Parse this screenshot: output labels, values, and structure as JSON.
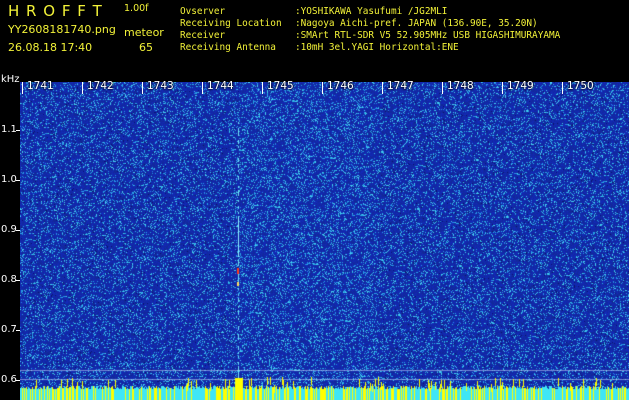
{
  "header": {
    "brand": "H R O F F T",
    "version": "1.00f",
    "filename": "YY2608181740.png",
    "meteor_label": "meteor",
    "datetime": "26.08.18 17:40",
    "meteor_count": "65",
    "info_labels": [
      "Ovserver",
      "Receiving Location",
      "Receiver",
      "Receiving Antenna"
    ],
    "info_values": [
      ":YOSHIKAWA Yasufumi /JG2MLI",
      ":Nagoya Aichi-pref. JAPAN (136.90E, 35.20N)",
      ":SMArt RTL-SDR V5 52.905MHz USB HIGASHIMURAYAMA",
      ":10mH 3el.YAGI Horizontal:ENE"
    ]
  },
  "axis": {
    "unit": "kHz",
    "ticks": [
      "1.1",
      "1.0",
      "0.9",
      "0.8",
      "0.7",
      "0.6"
    ]
  },
  "time_labels": [
    "1741",
    "1742",
    "1743",
    "1744",
    "1745",
    "1746",
    "1747",
    "1748",
    "1749",
    "1750"
  ],
  "colors": {
    "header_yellow": "#f2f238",
    "spectrogram_base": "#1f3aa8",
    "noise_cyan": "#49e4f0",
    "meteor_red": "#ff3a1e",
    "floor_yellow": "#ffff00"
  },
  "meteor_event_minute": "1744"
}
